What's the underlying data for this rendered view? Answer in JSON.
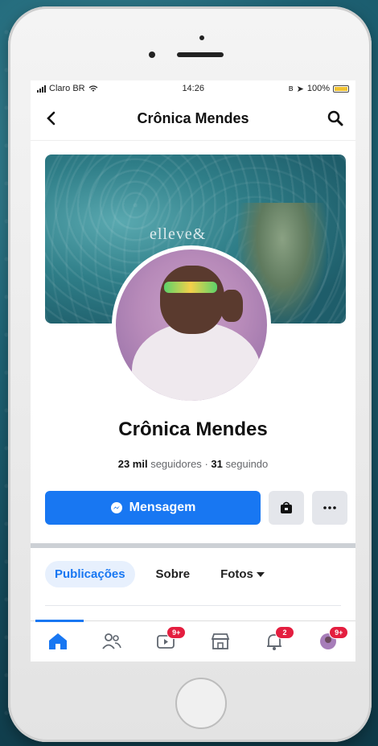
{
  "status_bar": {
    "carrier": "Claro BR",
    "time": "14:26",
    "battery": "100%"
  },
  "header": {
    "title": "Crônica Mendes"
  },
  "cover": {
    "logo_text": "elleve&"
  },
  "profile": {
    "name": "Crônica Mendes",
    "followers_count": "23 mil",
    "followers_label": "seguidores",
    "separator": "·",
    "following_count": "31",
    "following_label": "seguindo"
  },
  "actions": {
    "message_label": "Mensagem"
  },
  "tabs": [
    {
      "label": "Publicações",
      "active": true
    },
    {
      "label": "Sobre"
    },
    {
      "label": "Fotos"
    }
  ],
  "tabbar": {
    "videos_badge": "9+",
    "notifications_badge": "2",
    "menu_badge": "9+"
  },
  "colors": {
    "accent": "#1877f2",
    "badge": "#e41e3f"
  }
}
